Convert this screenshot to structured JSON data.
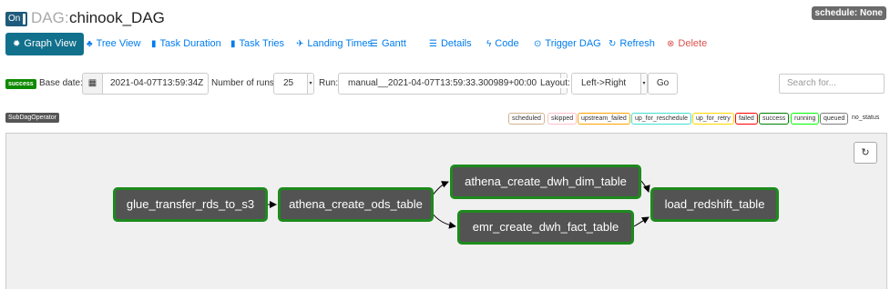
{
  "header": {
    "toggle_label": "On",
    "dag_prefix": "DAG:",
    "dag_id": "chinook_DAG",
    "schedule": "schedule: None"
  },
  "tabs": [
    {
      "label": "Graph View",
      "icon": "gear-icon"
    },
    {
      "label": "Tree View",
      "icon": "tree-icon"
    },
    {
      "label": "Task Duration",
      "icon": "chart-bar-icon"
    },
    {
      "label": "Task Tries",
      "icon": "chart-bar-icon"
    },
    {
      "label": "Landing Times",
      "icon": "plane-icon"
    },
    {
      "label": "Gantt",
      "icon": "gantt-icon"
    },
    {
      "label": "Details",
      "icon": "list-icon"
    },
    {
      "label": "Code",
      "icon": "bolt-icon"
    },
    {
      "label": "Trigger DAG",
      "icon": "play-circle-icon"
    },
    {
      "label": "Refresh",
      "icon": "refresh-icon"
    },
    {
      "label": "Delete",
      "icon": "delete-icon"
    }
  ],
  "controls": {
    "state_badge": "success",
    "base_date_label": "Base date:",
    "base_date_value": "2021-04-07T13:59:34Z",
    "num_runs_label": "Number of runs:",
    "num_runs_value": "25",
    "run_label": "Run:",
    "run_value": "manual__2021-04-07T13:59:33.300989+00:00",
    "layout_label": "Layout:",
    "layout_value": "Left->Right",
    "go_label": "Go",
    "search_placeholder": "Search for..."
  },
  "operator_badge": "SubDagOperator",
  "legend": [
    {
      "label": "scheduled",
      "color": "#d2b48c"
    },
    {
      "label": "skipped",
      "color": "#ffc0cb"
    },
    {
      "label": "upstream_failed",
      "color": "#ffa500"
    },
    {
      "label": "up_for_reschedule",
      "color": "#40e0d0"
    },
    {
      "label": "up_for_retry",
      "color": "#ffd700"
    },
    {
      "label": "failed",
      "color": "#ff0000"
    },
    {
      "label": "success",
      "color": "#008000"
    },
    {
      "label": "running",
      "color": "#00ff00"
    },
    {
      "label": "queued",
      "color": "#808080"
    },
    {
      "label": "no_status",
      "color": "#ffffff"
    }
  ],
  "graph": {
    "nodes": [
      {
        "id": "glue_transfer_rds_to_s3",
        "label": "glue_transfer_rds_to_s3"
      },
      {
        "id": "athena_create_ods_table",
        "label": "athena_create_ods_table"
      },
      {
        "id": "athena_create_dwh_dim_table",
        "label": "athena_create_dwh_dim_table"
      },
      {
        "id": "emr_create_dwh_fact_table",
        "label": "emr_create_dwh_fact_table"
      },
      {
        "id": "load_redshift_table",
        "label": "load_redshift_table"
      }
    ],
    "edges": [
      [
        "glue_transfer_rds_to_s3",
        "athena_create_ods_table"
      ],
      [
        "athena_create_ods_table",
        "athena_create_dwh_dim_table"
      ],
      [
        "athena_create_ods_table",
        "emr_create_dwh_fact_table"
      ],
      [
        "athena_create_dwh_dim_table",
        "load_redshift_table"
      ],
      [
        "emr_create_dwh_fact_table",
        "load_redshift_table"
      ]
    ],
    "node_border_color": "#1d8a1d"
  }
}
